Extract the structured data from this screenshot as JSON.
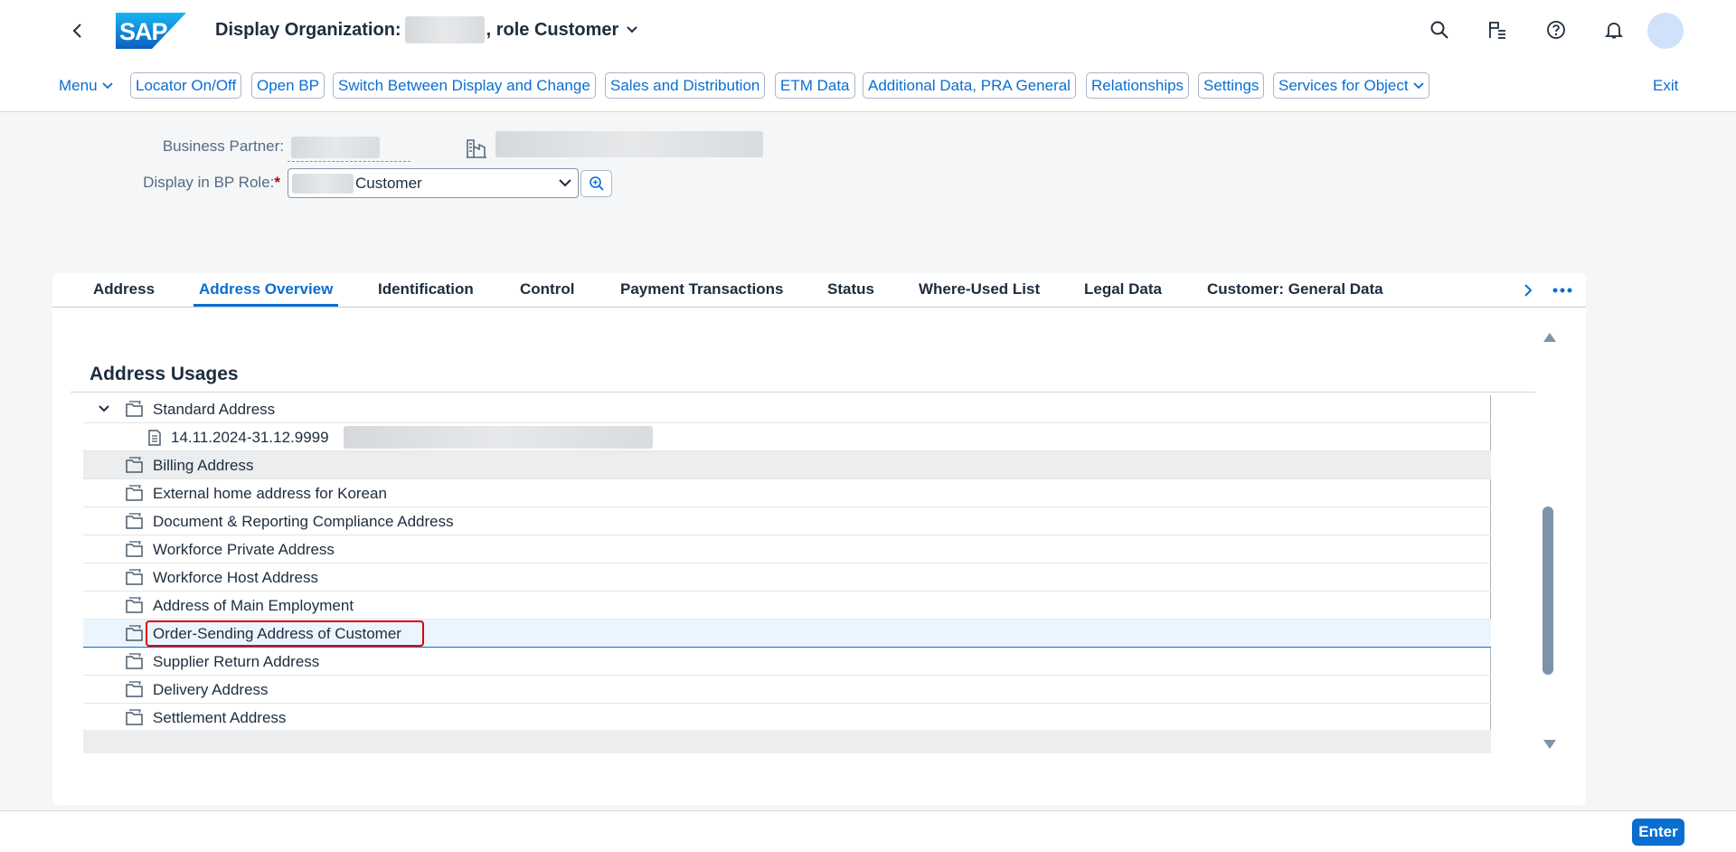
{
  "shell": {
    "title_prefix": "Display Organization:",
    "title_suffix": ", role Customer",
    "icons": [
      "back-icon",
      "search-icon",
      "flag-list-icon",
      "help-icon",
      "bell-icon"
    ]
  },
  "toolbar": {
    "menu": "Menu",
    "buttons": [
      "Locator On/Off",
      "Open BP",
      "Switch Between Display and Change",
      "Sales and Distribution",
      "ETM Data",
      "Additional Data, PRA General",
      "Relationships",
      "Settings",
      "Services for Object"
    ],
    "exit": "Exit"
  },
  "form": {
    "bp_label": "Business Partner:",
    "role_label": "Display in BP Role:",
    "required_marker": "*",
    "role_value": "Customer"
  },
  "tabs": [
    "Address",
    "Address Overview",
    "Identification",
    "Control",
    "Payment Transactions",
    "Status",
    "Where-Used List",
    "Legal Data",
    "Customer: General Data"
  ],
  "active_tab": "Address Overview",
  "section": {
    "title": "Address Usages",
    "standard": "Standard Address",
    "standard_validity": "14.11.2024-31.12.9999",
    "items": [
      "Billing Address",
      "External home address for Korean",
      "Document & Reporting Compliance Address",
      "Workforce Private Address",
      "Workforce Host Address",
      "Address of Main Employment",
      "Order-Sending Address of Customer",
      "Supplier Return Address",
      "Delivery Address",
      "Settlement Address"
    ],
    "selected_item": "Order-Sending Address of Customer"
  },
  "footer": {
    "enter": "Enter"
  },
  "colors": {
    "accent": "#0a6ed1",
    "focus": "#e00000",
    "row_highlight": "#ebedef",
    "row_selected": "#ebf5fe"
  }
}
